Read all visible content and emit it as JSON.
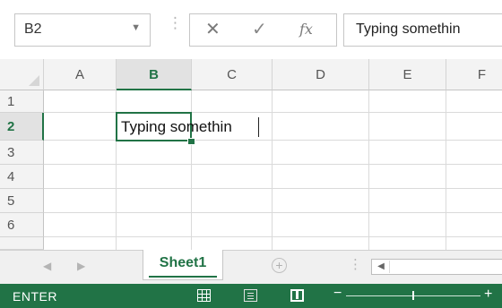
{
  "formula_bar": {
    "name_box": "B2",
    "name_box_arrow": "▼",
    "separator": "⋮",
    "cancel_symbol": "✕",
    "enter_symbol": "✓",
    "fx_label": "fx",
    "formula_value": "Typing somethin"
  },
  "grid": {
    "columns": [
      "A",
      "B",
      "C",
      "D",
      "E",
      "F"
    ],
    "rows": [
      "1",
      "2",
      "3",
      "4",
      "5",
      "6"
    ],
    "active_column": "B",
    "active_row": "2",
    "active_cell_value": "Typing somethin"
  },
  "sheet_tabs": {
    "prev_arrow": "◀",
    "next_arrow": "▶",
    "active_sheet": "Sheet1",
    "add_sheet_symbol": "+",
    "separator": "⋮",
    "scroll_left": "◀"
  },
  "status_bar": {
    "mode": "ENTER",
    "zoom_minus": "−",
    "zoom_plus": "+",
    "accent_color": "#217346"
  }
}
